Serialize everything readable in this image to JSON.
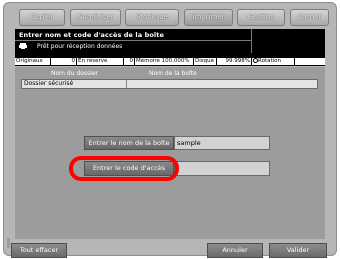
{
  "tabs": [
    "Copier",
    "Numériser",
    "Stockage",
    "Imprimer",
    "Gestion",
    "Carnet"
  ],
  "header": {
    "title": "Entrer nom et code d'accès de la boîte",
    "status": "Prêt pour réception données"
  },
  "status_bar": {
    "originals": "Originaux",
    "originals_count": "0",
    "reserved": "En réserve",
    "reserved_count": "0",
    "memory": "Mémoire 100.000%",
    "disk": "Disque",
    "disk_value": "99.998%",
    "rotation": "Rotation"
  },
  "table": {
    "col_folder": "Nom du dossier",
    "col_box": "Nom de la boîte",
    "rows": [
      {
        "folder": "Dossier sécurisé"
      }
    ]
  },
  "form": {
    "box_name_button": "Entrer le nom de la boîte",
    "box_name_value": "sample",
    "access_code_button": "Entrer le code d'accès",
    "access_code_value": ""
  },
  "footer": {
    "clear_all": "Tout effacer",
    "cancel": "Annuler",
    "ok": "Valider"
  }
}
